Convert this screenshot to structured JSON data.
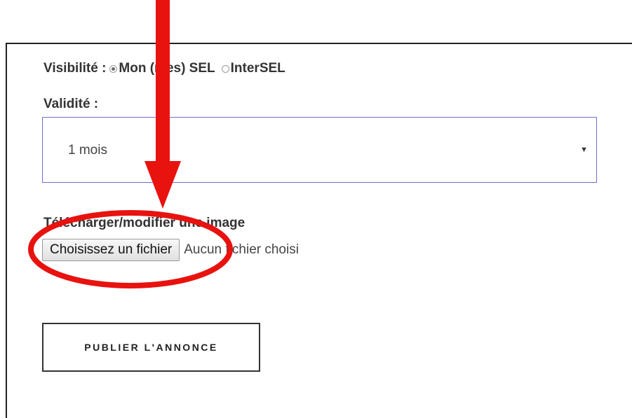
{
  "form": {
    "visibility": {
      "label": "Visibilité :",
      "options": [
        {
          "label": "Mon (mes) SEL",
          "checked": true
        },
        {
          "label": "InterSEL",
          "checked": false
        }
      ]
    },
    "validity": {
      "label": "Validité :",
      "selected_value": "1 mois"
    },
    "image_upload": {
      "label": "Télécharger/modifier une image",
      "button_label": "Choisissez un fichier",
      "status_text": "Aucun fichier choisi"
    },
    "submit_label": "PUBLIER L'ANNONCE"
  },
  "annotations": {
    "arrow_color": "#e8120f",
    "ellipse_color": "#e8120f"
  }
}
